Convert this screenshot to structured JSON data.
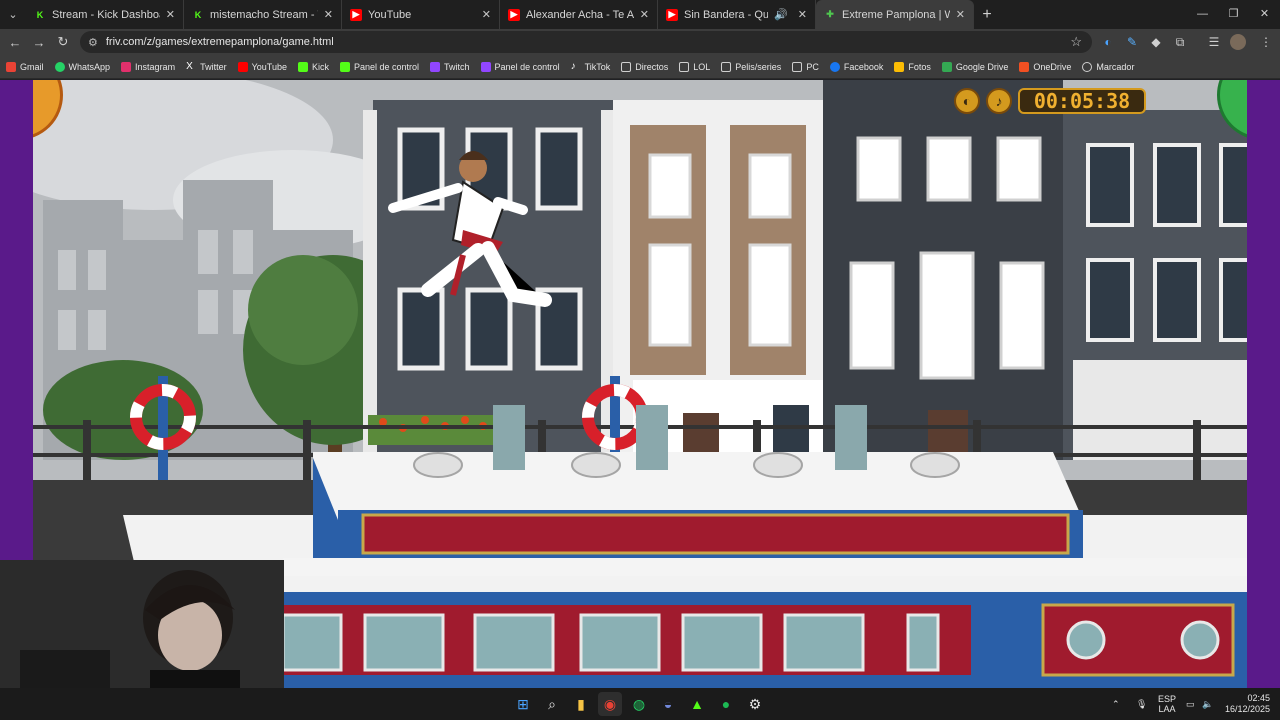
{
  "tabs": [
    {
      "title": "Stream - Kick Dashboard",
      "icon": "kick-icon",
      "color": "#53fc18"
    },
    {
      "title": "mistemacho Stream - Watch Li",
      "icon": "kick-icon",
      "color": "#53fc18"
    },
    {
      "title": "YouTube",
      "icon": "youtube-icon",
      "color": "#ff0000"
    },
    {
      "title": "Alexander Acha - Te Amo (Offic",
      "icon": "youtube-icon",
      "color": "#ff0000"
    },
    {
      "title": "Sin Bandera - Que Lloro (Vi",
      "icon": "youtube-icon",
      "color": "#ff0000"
    },
    {
      "title": "Extreme Pamplona | Works On",
      "icon": "friv-icon",
      "color": "#4fc64f"
    }
  ],
  "address": {
    "url": "friv.com/z/games/extremepamplona/game.html"
  },
  "bookmarks": [
    {
      "label": "Gmail",
      "icon": "gmail-icon",
      "color": "#ea4335"
    },
    {
      "label": "WhatsApp",
      "icon": "whatsapp-icon",
      "color": "#25d366"
    },
    {
      "label": "Instagram",
      "icon": "instagram-icon",
      "color": "#e1306c"
    },
    {
      "label": "Twitter",
      "icon": "x-icon",
      "color": "#ffffff"
    },
    {
      "label": "YouTube",
      "icon": "youtube-icon",
      "color": "#ff0000"
    },
    {
      "label": "Kick",
      "icon": "kick-icon",
      "color": "#53fc18"
    },
    {
      "label": "Panel de control",
      "icon": "kick-icon",
      "color": "#53fc18"
    },
    {
      "label": "Twitch",
      "icon": "twitch-icon",
      "color": "#9146ff"
    },
    {
      "label": "Panel de control",
      "icon": "twitch-icon",
      "color": "#9146ff"
    },
    {
      "label": "TikTok",
      "icon": "tiktok-icon",
      "color": "#ffffff"
    },
    {
      "label": "Directos",
      "icon": "folder-icon",
      "color": "#cfcfcf"
    },
    {
      "label": "LOL",
      "icon": "folder-icon",
      "color": "#cfcfcf"
    },
    {
      "label": "Pelis/series",
      "icon": "folder-icon",
      "color": "#cfcfcf"
    },
    {
      "label": "PC",
      "icon": "folder-icon",
      "color": "#cfcfcf"
    },
    {
      "label": "Facebook",
      "icon": "facebook-icon",
      "color": "#1877f2"
    },
    {
      "label": "Fotos",
      "icon": "photos-icon",
      "color": "#fbbc04"
    },
    {
      "label": "Google Drive",
      "icon": "drive-icon",
      "color": "#34a853"
    },
    {
      "label": "OneDrive",
      "icon": "onedrive-icon",
      "color": "#f25022"
    },
    {
      "label": "Marcador",
      "icon": "globe-icon",
      "color": "#cfcfcf"
    }
  ],
  "game": {
    "timer": "00:05:38"
  },
  "tray": {
    "language": "ESP",
    "layout": "LAA",
    "time": "02:45",
    "date": "16/12/2025"
  },
  "colors": {
    "accent": "#d49a1e",
    "boat_blue": "#2a5fa8",
    "boat_red": "#a01b2e"
  }
}
